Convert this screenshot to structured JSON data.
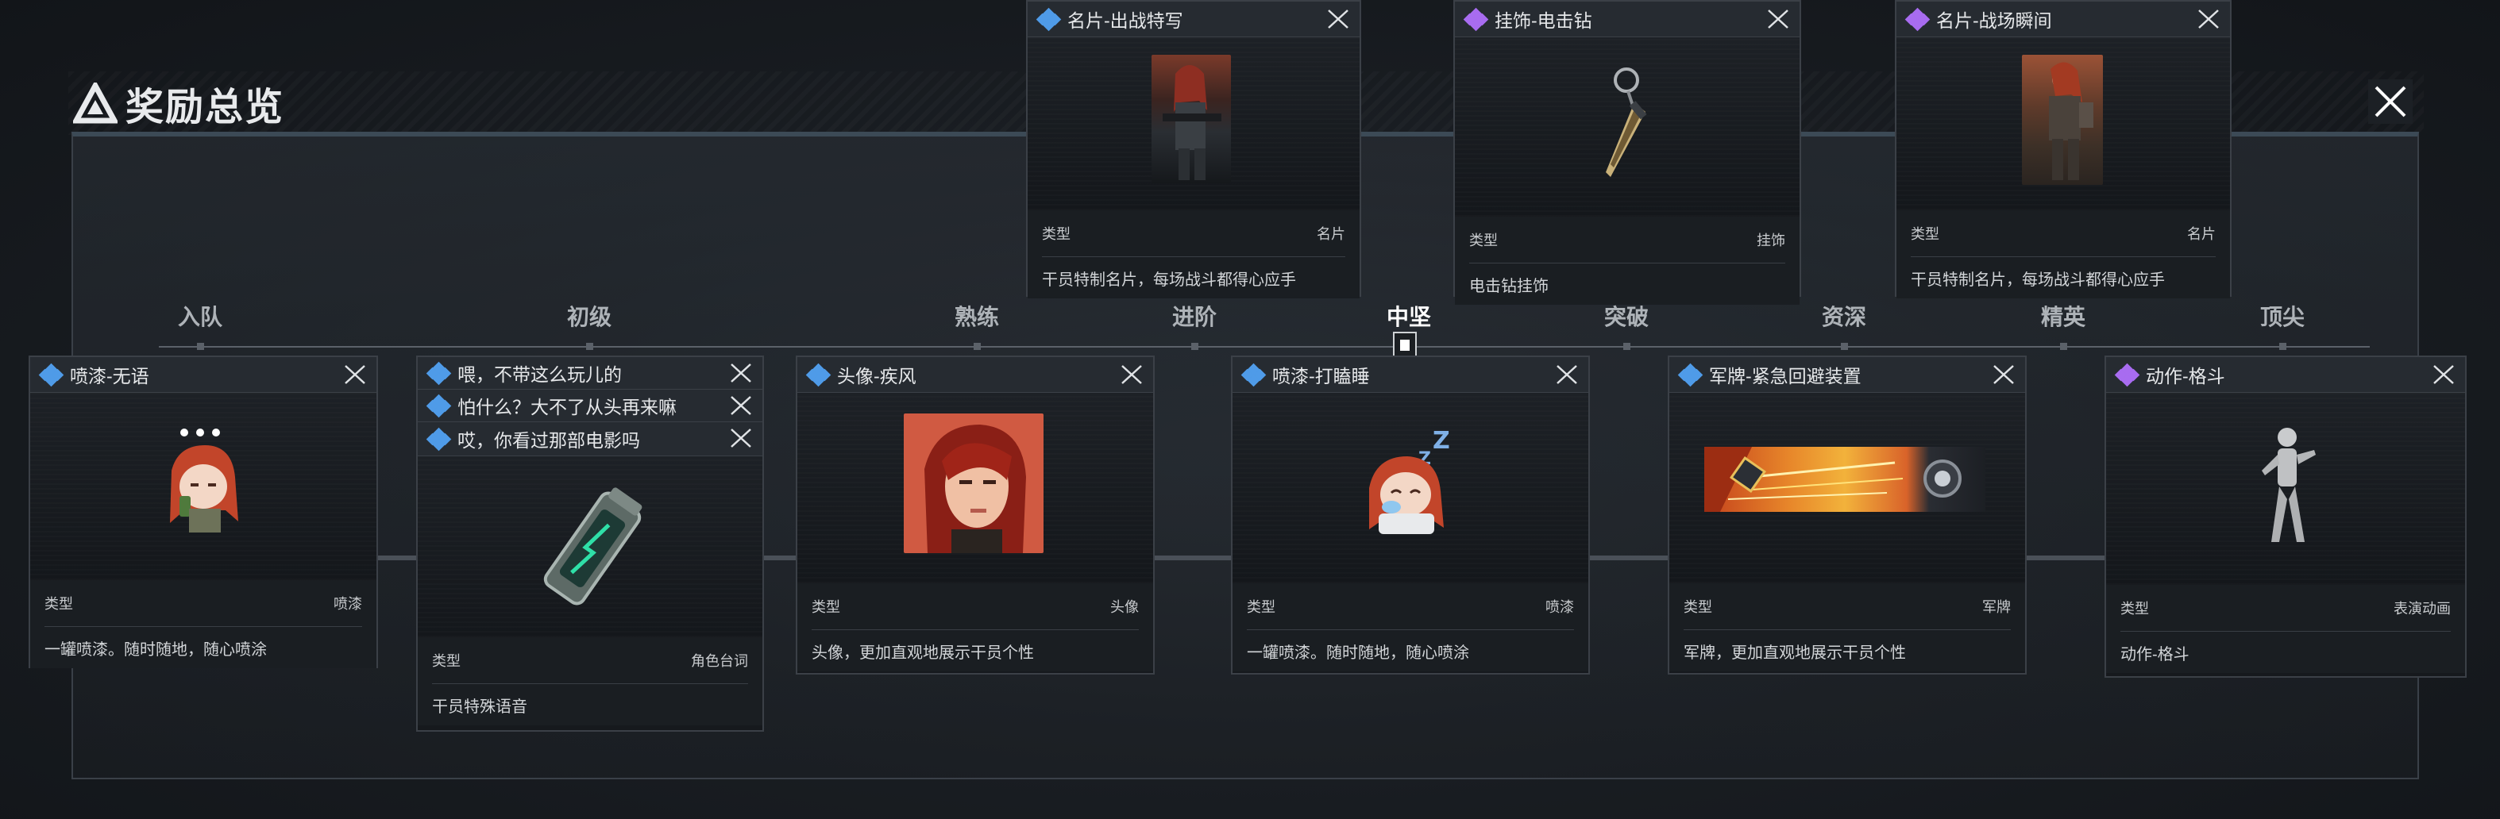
{
  "header": {
    "title": "奖励总览"
  },
  "timeline": {
    "stages": [
      "入队",
      "初级",
      "熟练",
      "进阶",
      "中坚",
      "突破",
      "资深",
      "精英",
      "顶尖"
    ],
    "active_index": 4
  },
  "colors": {
    "rarity_blue": "#4f9be8",
    "rarity_purple": "#a86cf0"
  },
  "type_label": "类型",
  "top_cards": [
    {
      "title": "名片-出战特写",
      "rarity": "blue",
      "type": "名片",
      "desc": "干员特制名片，每场战斗都得心应手",
      "icon": "operator-card-portrait"
    },
    {
      "title": "挂饰-电击钻",
      "rarity": "purple",
      "type": "挂饰",
      "desc": "电击钻挂饰",
      "icon": "drill-charm"
    },
    {
      "title": "名片-战场瞬间",
      "rarity": "purple",
      "type": "名片",
      "desc": "干员特制名片，每场战斗都得心应手",
      "icon": "operator-card-portrait"
    }
  ],
  "bottom_cards": [
    {
      "title": "喷漆-无语",
      "rarity": "blue",
      "type": "喷漆",
      "desc": "一罐喷漆。随时随地，随心喷涂",
      "icon": "spray-speechless"
    },
    {
      "titles": [
        "喂，不带这么玩儿的",
        "怕什么？大不了从头再来嘛",
        "哎，你看过那部电影吗"
      ],
      "rarity": "blue",
      "type": "角色台词",
      "desc": "干员特殊语音",
      "icon": "voice-canister"
    },
    {
      "title": "头像-疾风",
      "rarity": "blue",
      "type": "头像",
      "desc": "头像，更加直观地展示干员个性",
      "icon": "avatar-portrait"
    },
    {
      "title": "喷漆-打瞌睡",
      "rarity": "blue",
      "type": "喷漆",
      "desc": "一罐喷漆。随时随地，随心喷涂",
      "icon": "spray-sleepy"
    },
    {
      "title": "军牌-紧急回避装置",
      "rarity": "blue",
      "type": "军牌",
      "desc": "军牌，更加直观地展示干员个性",
      "icon": "dog-tag-banner"
    },
    {
      "title": "动作-格斗",
      "rarity": "purple",
      "type": "表演动画",
      "desc": "动作-格斗",
      "icon": "emote-figure"
    }
  ]
}
